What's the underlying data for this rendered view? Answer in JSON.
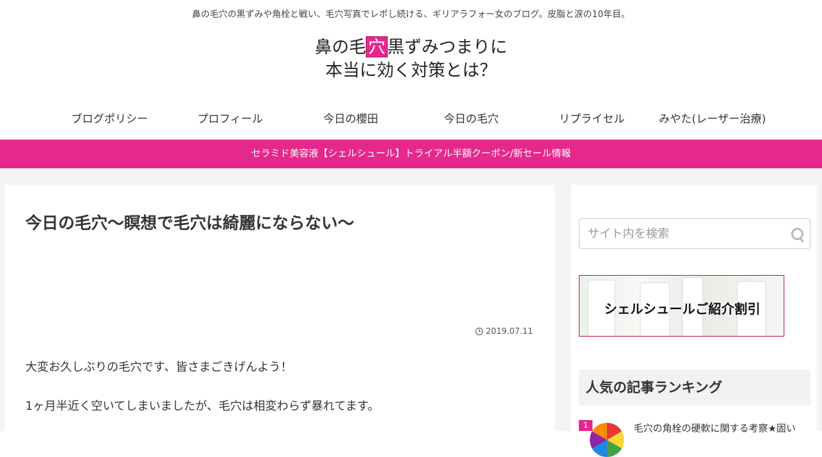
{
  "header": {
    "tagline": "鼻の毛穴の黒ずみや角栓と戦い、毛穴写真でレポし続ける、ギリアラフォー女のブログ。皮脂と涙の10年目。",
    "title_line1_pre": "鼻の毛",
    "title_line1_highlight": "穴",
    "title_line1_post": "黒ずみつまりに",
    "title_line2": "本当に効く対策とは？"
  },
  "nav": {
    "items": [
      {
        "label": "ブログポリシー"
      },
      {
        "label": "プロフィール"
      },
      {
        "label": "今日の櫻田"
      },
      {
        "label": "今日の毛穴"
      },
      {
        "label": "リプライセル"
      },
      {
        "label": "みやた(レーザー治療)"
      }
    ]
  },
  "notice": {
    "text": "セラミド美容液【シェルシュール】トライアル半額クーポン/新セール情報"
  },
  "article": {
    "title": "今日の毛穴〜瞑想で毛穴は綺麗にならない〜",
    "date": "2019.07.11",
    "paragraphs": [
      "大変お久しぶりの毛穴です、皆さまごきげんよう！",
      "1ヶ月半近く空いてしまいましたが、毛穴は相変わらず暴れてます。"
    ]
  },
  "sidebar": {
    "search_placeholder": "サイト内を検索",
    "banner_text": "シェルシュールご紹介割引",
    "ranking_heading": "人気の記事ランキング",
    "ranking": [
      {
        "rank": "1",
        "title": "毛穴の角栓の硬軟に関する考察★固い"
      }
    ]
  },
  "colors": {
    "accent": "#e6288c"
  }
}
